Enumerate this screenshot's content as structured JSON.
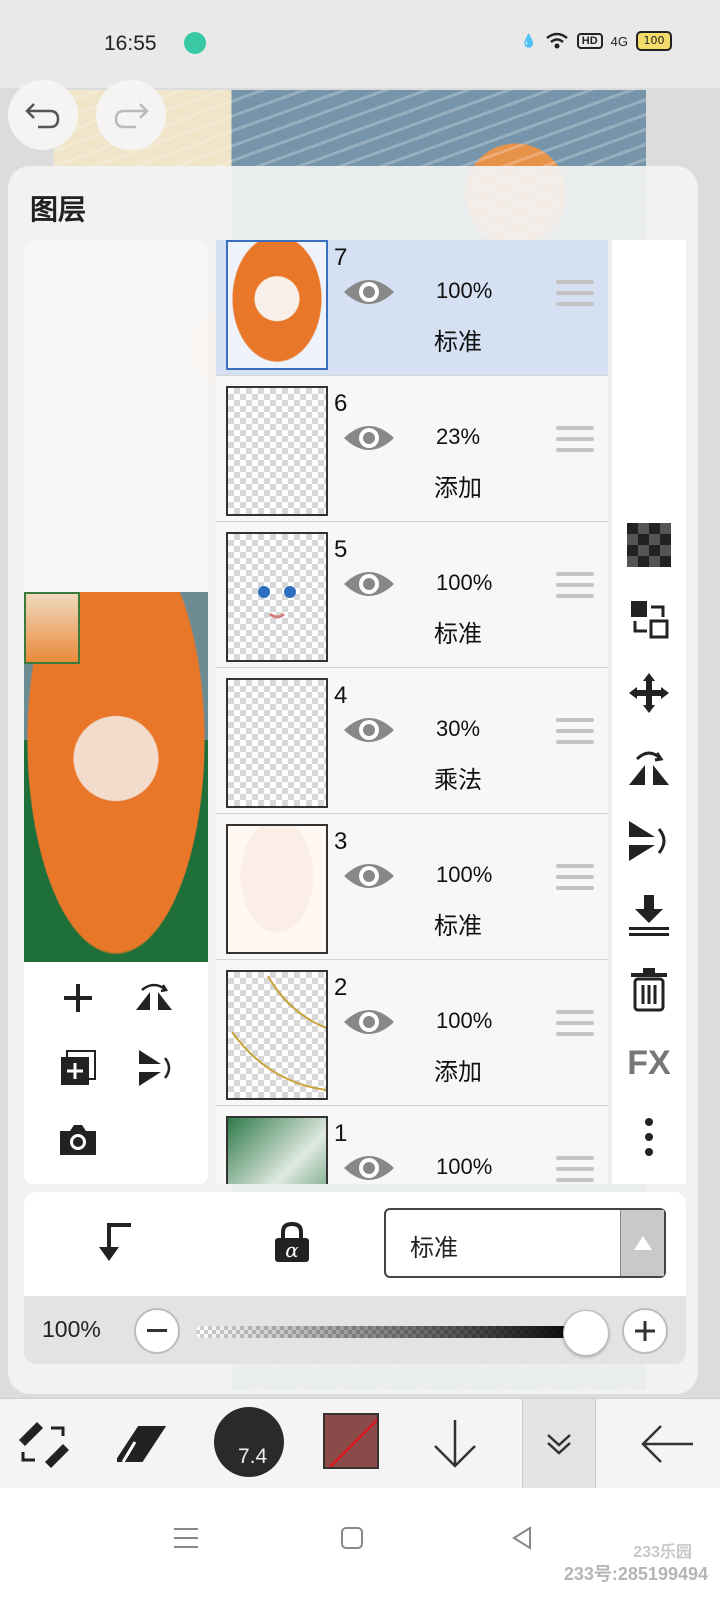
{
  "status_bar": {
    "time": "16:55",
    "network": "4G",
    "hd": "HD",
    "battery": "100"
  },
  "panel": {
    "title": "图层"
  },
  "layers": [
    {
      "number": "7",
      "opacity": "100%",
      "mode": "标准",
      "selected": true
    },
    {
      "number": "6",
      "opacity": "23%",
      "mode": "添加",
      "selected": false
    },
    {
      "number": "5",
      "opacity": "100%",
      "mode": "标准",
      "selected": false
    },
    {
      "number": "4",
      "opacity": "30%",
      "mode": "乘法",
      "selected": false
    },
    {
      "number": "3",
      "opacity": "100%",
      "mode": "标准",
      "selected": false
    },
    {
      "number": "2",
      "opacity": "100%",
      "mode": "添加",
      "selected": false
    },
    {
      "number": "1",
      "opacity": "100%",
      "mode": "",
      "selected": false
    }
  ],
  "right_tools": {
    "fx_label": "FX"
  },
  "blend": {
    "selected": "标准",
    "lock_label": "α"
  },
  "opacity": {
    "label": "100%",
    "value": 1.0
  },
  "toolbar": {
    "brush_size": "7.4",
    "color": "#8b4a4a"
  },
  "watermark": {
    "logo": "233乐园",
    "text": "233号:285199494"
  }
}
